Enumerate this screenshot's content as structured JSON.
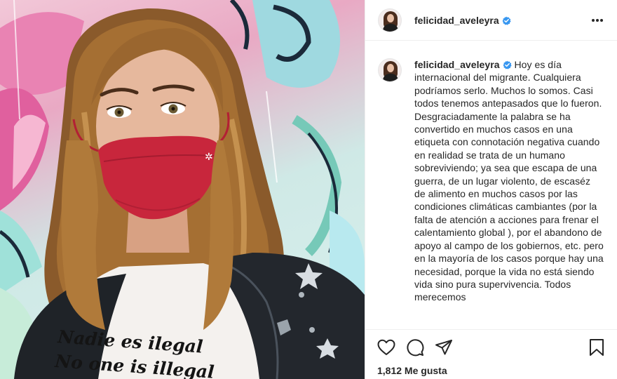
{
  "post": {
    "username": "felicidad_aveleyra",
    "verified": true,
    "more_icon": "more-horizontal-icon",
    "caption": "Hoy es día internacional del migrante. Cualquiera podríamos serlo. Muchos lo somos. Casi todos tenemos antepasados que lo fueron. Desgraciadamente la palabra se ha convertido en muchos casos en una etiqueta con connotación negativa cuando en realidad se trata de un humano sobreviviendo; ya sea que escapa de una guerra, de un lugar violento, de escaséz de alimento en muchos casos por las condiciones climáticas cambiantes (por la falta de atención a acciones para frenar el calentamiento global ), por el abandono de apoyo al campo de los gobiernos, etc. pero en la mayoría de los casos porque hay una necesidad, porque la vida no está siendo vida sino pura supervivencia. Todos merecemos",
    "likes_text": "1,812 Me gusta"
  },
  "photo": {
    "shirt_line1": "Nadie es ilegal",
    "shirt_line2": "No one is illegal"
  },
  "actions": {
    "icons": [
      "heart-icon",
      "comment-icon",
      "share-icon",
      "bookmark-icon"
    ]
  },
  "colors": {
    "verified_blue": "#3897f0",
    "mask_red": "#c8263c",
    "text": "#262626",
    "divider": "#efefef"
  }
}
